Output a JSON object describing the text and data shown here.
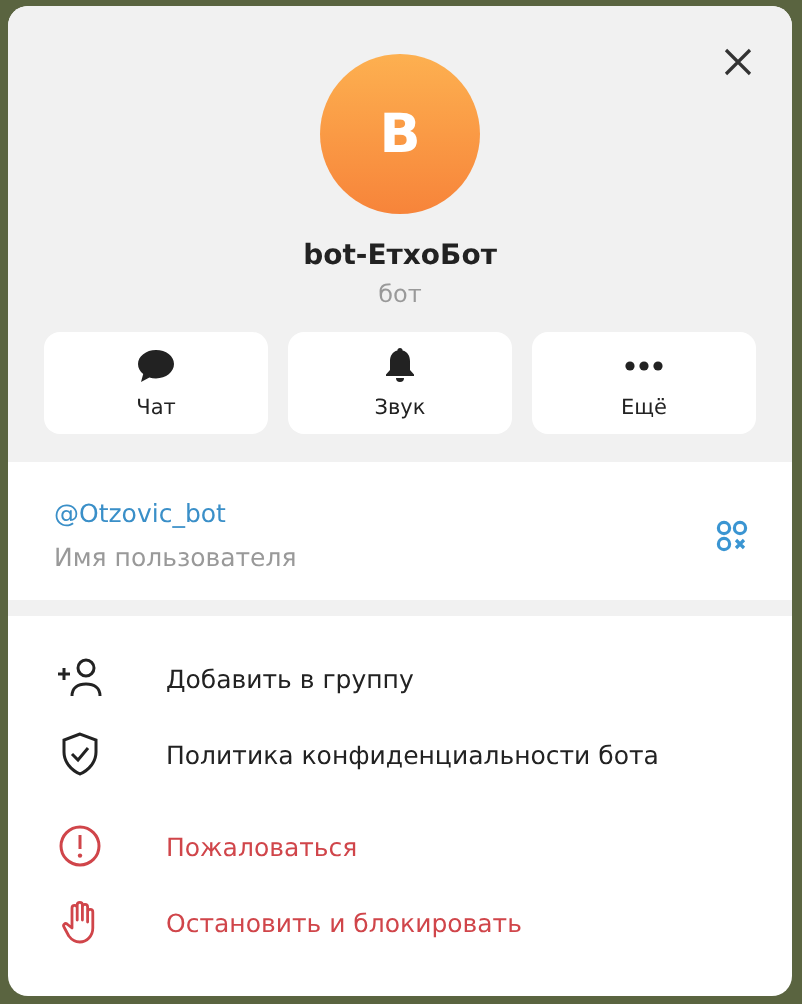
{
  "profile": {
    "avatar_letter": "B",
    "name": "bot-ЕтхоБот",
    "subtitle": "бот"
  },
  "quick_actions": [
    {
      "kind": "chat",
      "label": "Чат"
    },
    {
      "kind": "bell",
      "label": "Звук"
    },
    {
      "kind": "more",
      "label": "Ещё"
    }
  ],
  "username": {
    "value": "@Otzovic_bot",
    "label": "Имя пользователя"
  },
  "menu": [
    {
      "kind": "add-user",
      "label": "Добавить в группу",
      "danger": false
    },
    {
      "kind": "shield",
      "label": "Политика конфиденциальности бота",
      "danger": false
    },
    {
      "kind": "alert",
      "label": "Пожаловаться",
      "danger": true
    },
    {
      "kind": "hand",
      "label": "Остановить и блокировать",
      "danger": true
    }
  ]
}
